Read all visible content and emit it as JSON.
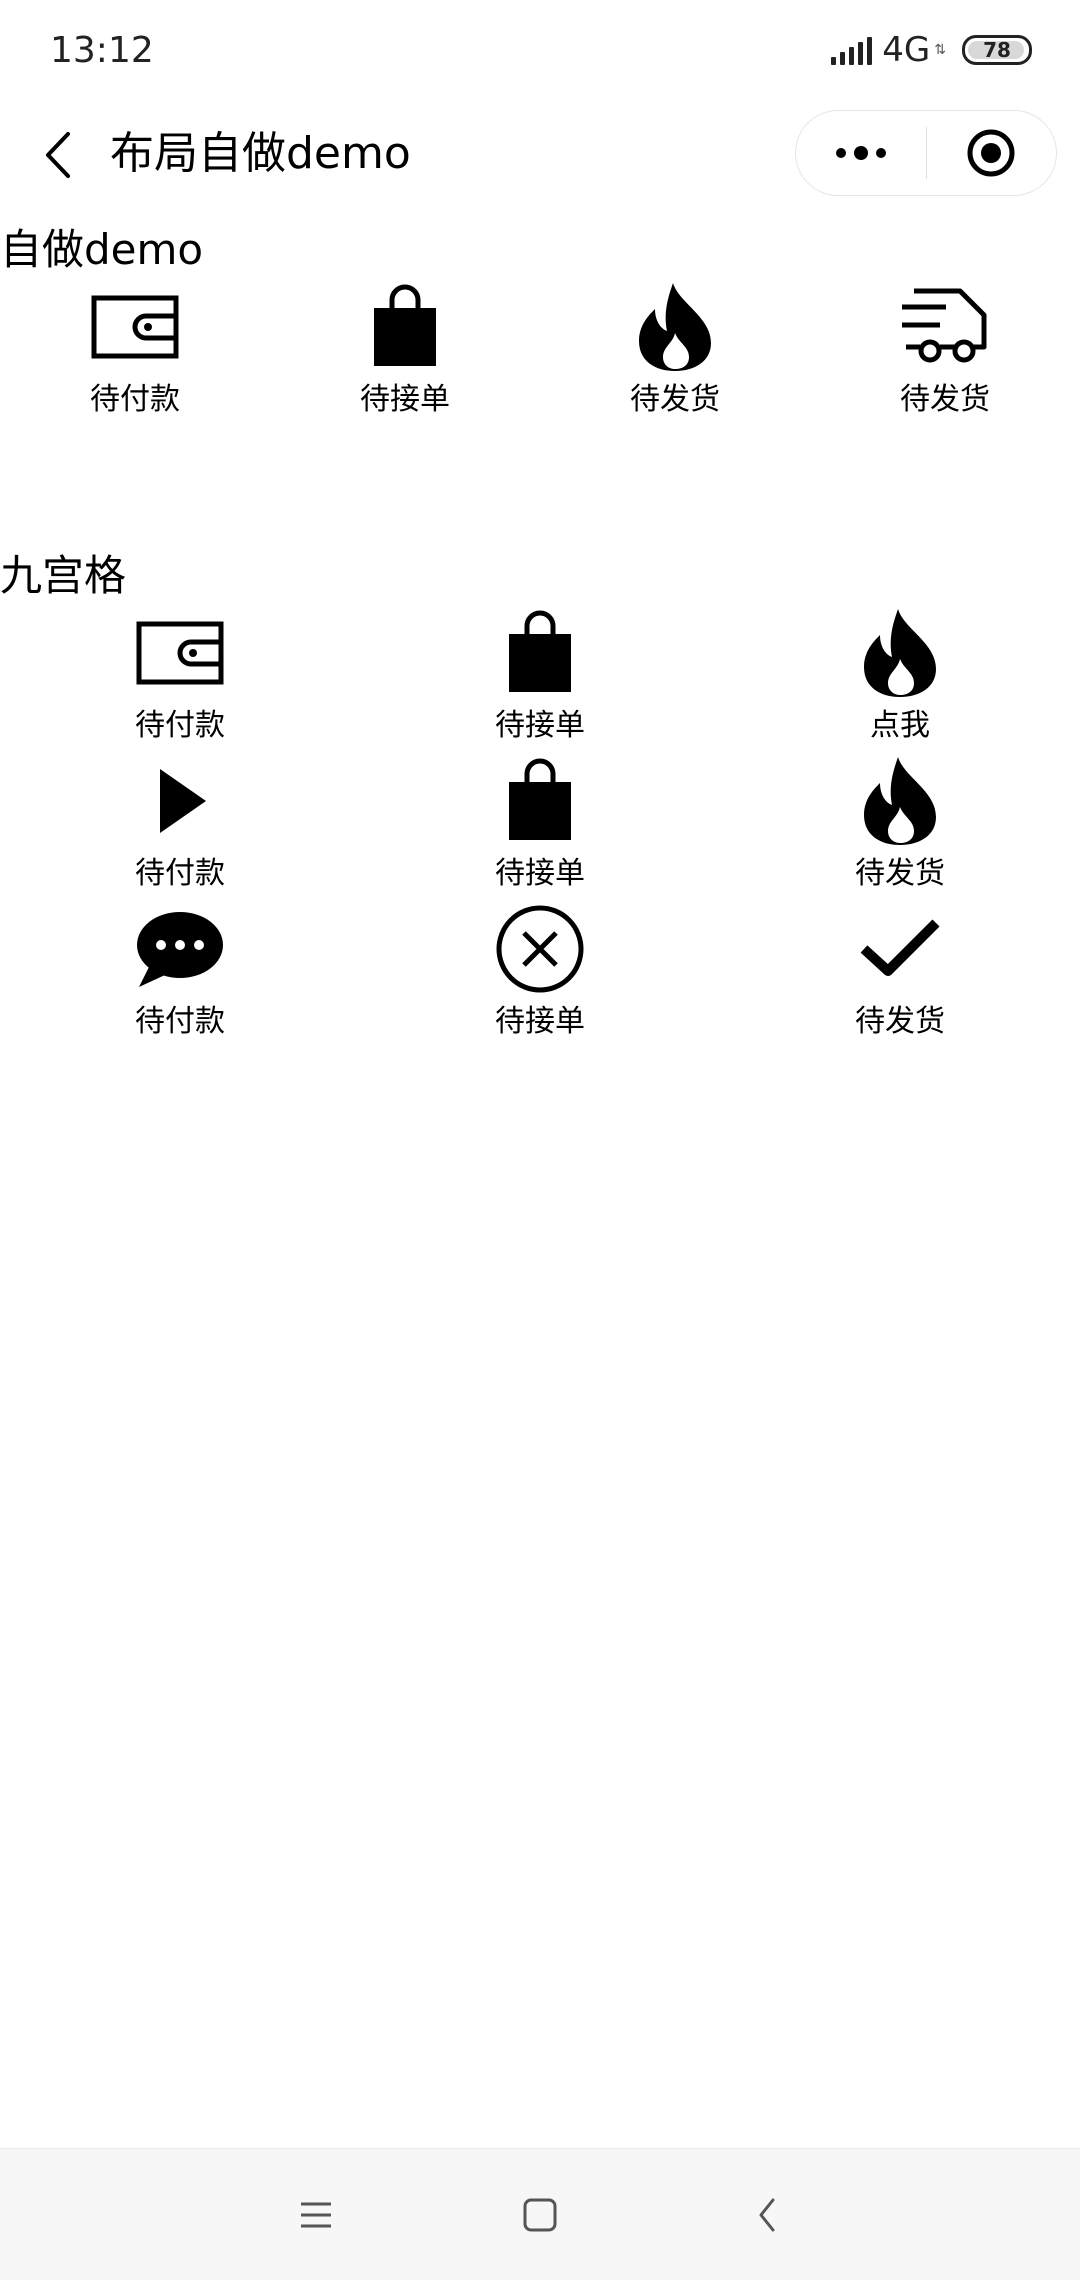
{
  "status_bar": {
    "time": "13:12",
    "network": "4G",
    "battery": "78"
  },
  "nav": {
    "title": "布局自做demo"
  },
  "section_demo": {
    "title": "自做demo",
    "items": [
      {
        "label": "待付款",
        "icon": "wallet-icon"
      },
      {
        "label": "待接单",
        "icon": "shopping-bag-icon"
      },
      {
        "label": "待发货",
        "icon": "fire-icon"
      },
      {
        "label": "待发货",
        "icon": "delivery-truck-icon"
      }
    ]
  },
  "section_grid": {
    "title": "九宫格",
    "items": [
      {
        "label": "待付款",
        "icon": "wallet-icon"
      },
      {
        "label": "待接单",
        "icon": "shopping-bag-icon"
      },
      {
        "label": "点我",
        "icon": "fire-icon"
      },
      {
        "label": "待付款",
        "icon": "play-icon"
      },
      {
        "label": "待接单",
        "icon": "shopping-bag-icon"
      },
      {
        "label": "待发货",
        "icon": "fire-icon"
      },
      {
        "label": "待付款",
        "icon": "chat-bubble-icon"
      },
      {
        "label": "待接单",
        "icon": "close-circle-icon"
      },
      {
        "label": "待发货",
        "icon": "checkmark-icon"
      }
    ]
  },
  "system_nav": {
    "buttons": [
      "menu-icon",
      "home-square-icon",
      "back-arrow-icon"
    ]
  }
}
